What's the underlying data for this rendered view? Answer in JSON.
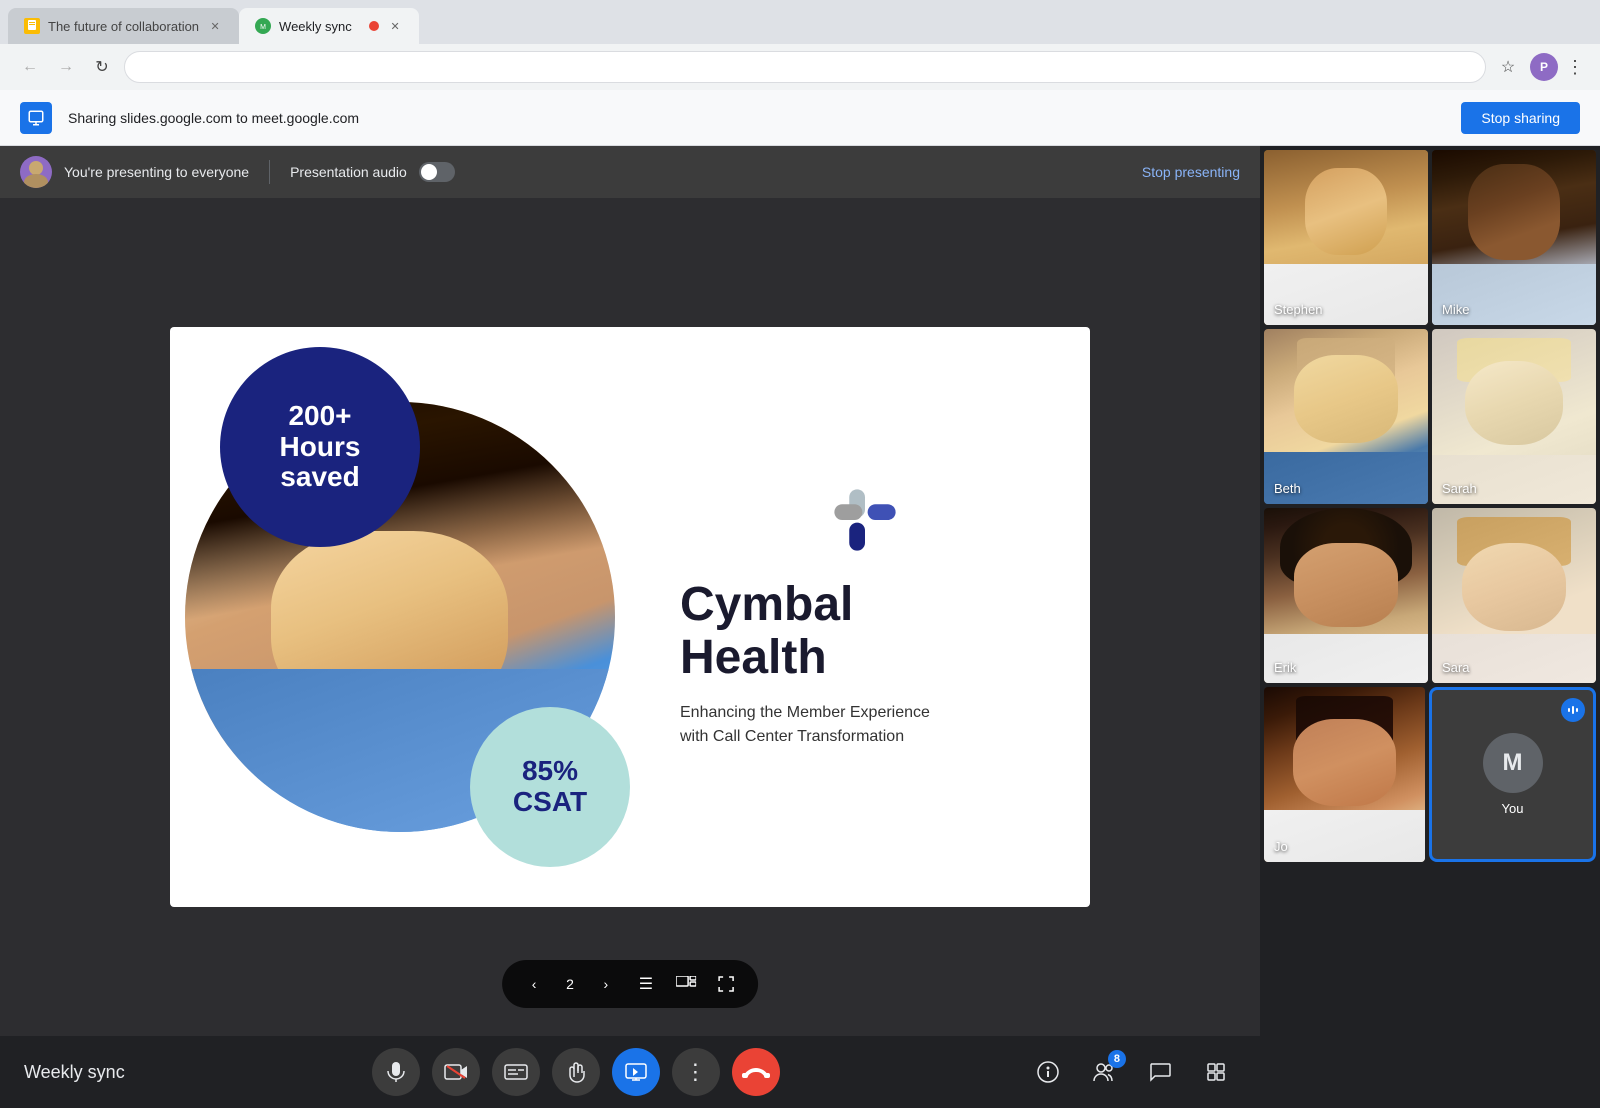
{
  "browser": {
    "tabs": [
      {
        "id": "slides-tab",
        "title": "The future of collaboration",
        "favicon_type": "slides",
        "active": false,
        "recording": false
      },
      {
        "id": "meet-tab",
        "title": "Weekly sync",
        "favicon_type": "meet",
        "active": true,
        "recording": true
      }
    ],
    "address": ""
  },
  "sharing_bar": {
    "text": "Sharing slides.google.com to meet.google.com",
    "stop_btn": "Stop sharing"
  },
  "presenter_bar": {
    "you_presenting": "You're presenting to everyone",
    "audio_label": "Presentation audio",
    "stop_btn": "Stop presenting"
  },
  "slide": {
    "dark_circle_line1": "200+",
    "dark_circle_line2": "Hours",
    "dark_circle_line3": "saved",
    "teal_line1": "85%",
    "teal_line2": "CSAT",
    "company_name_line1": "Cymbal",
    "company_name_line2": "Health",
    "subtitle_line1": "Enhancing the Member Experience",
    "subtitle_line2": "with Call Center Transformation",
    "nav_page": "2"
  },
  "participants": [
    {
      "name": "Stephen",
      "face_class": "face-stephen"
    },
    {
      "name": "Mike",
      "face_class": "face-mike"
    },
    {
      "name": "Beth",
      "face_class": "face-beth"
    },
    {
      "name": "Sarah",
      "face_class": "face-sarah"
    },
    {
      "name": "Erik",
      "face_class": "face-erik"
    },
    {
      "name": "Sara",
      "face_class": "face-sara"
    },
    {
      "name": "Jo",
      "face_class": "face-jo"
    },
    {
      "name": "You",
      "is_you": true
    }
  ],
  "toolbar": {
    "meeting_name": "Weekly sync",
    "mic_label": "Microphone",
    "video_label": "Camera",
    "cc_label": "Captions",
    "raise_label": "Raise hand",
    "share_label": "Present now",
    "more_label": "More options",
    "end_label": "Leave call",
    "info_label": "Meeting details",
    "people_label": "People",
    "people_badge": "8",
    "chat_label": "Chat",
    "activities_label": "Activities"
  }
}
